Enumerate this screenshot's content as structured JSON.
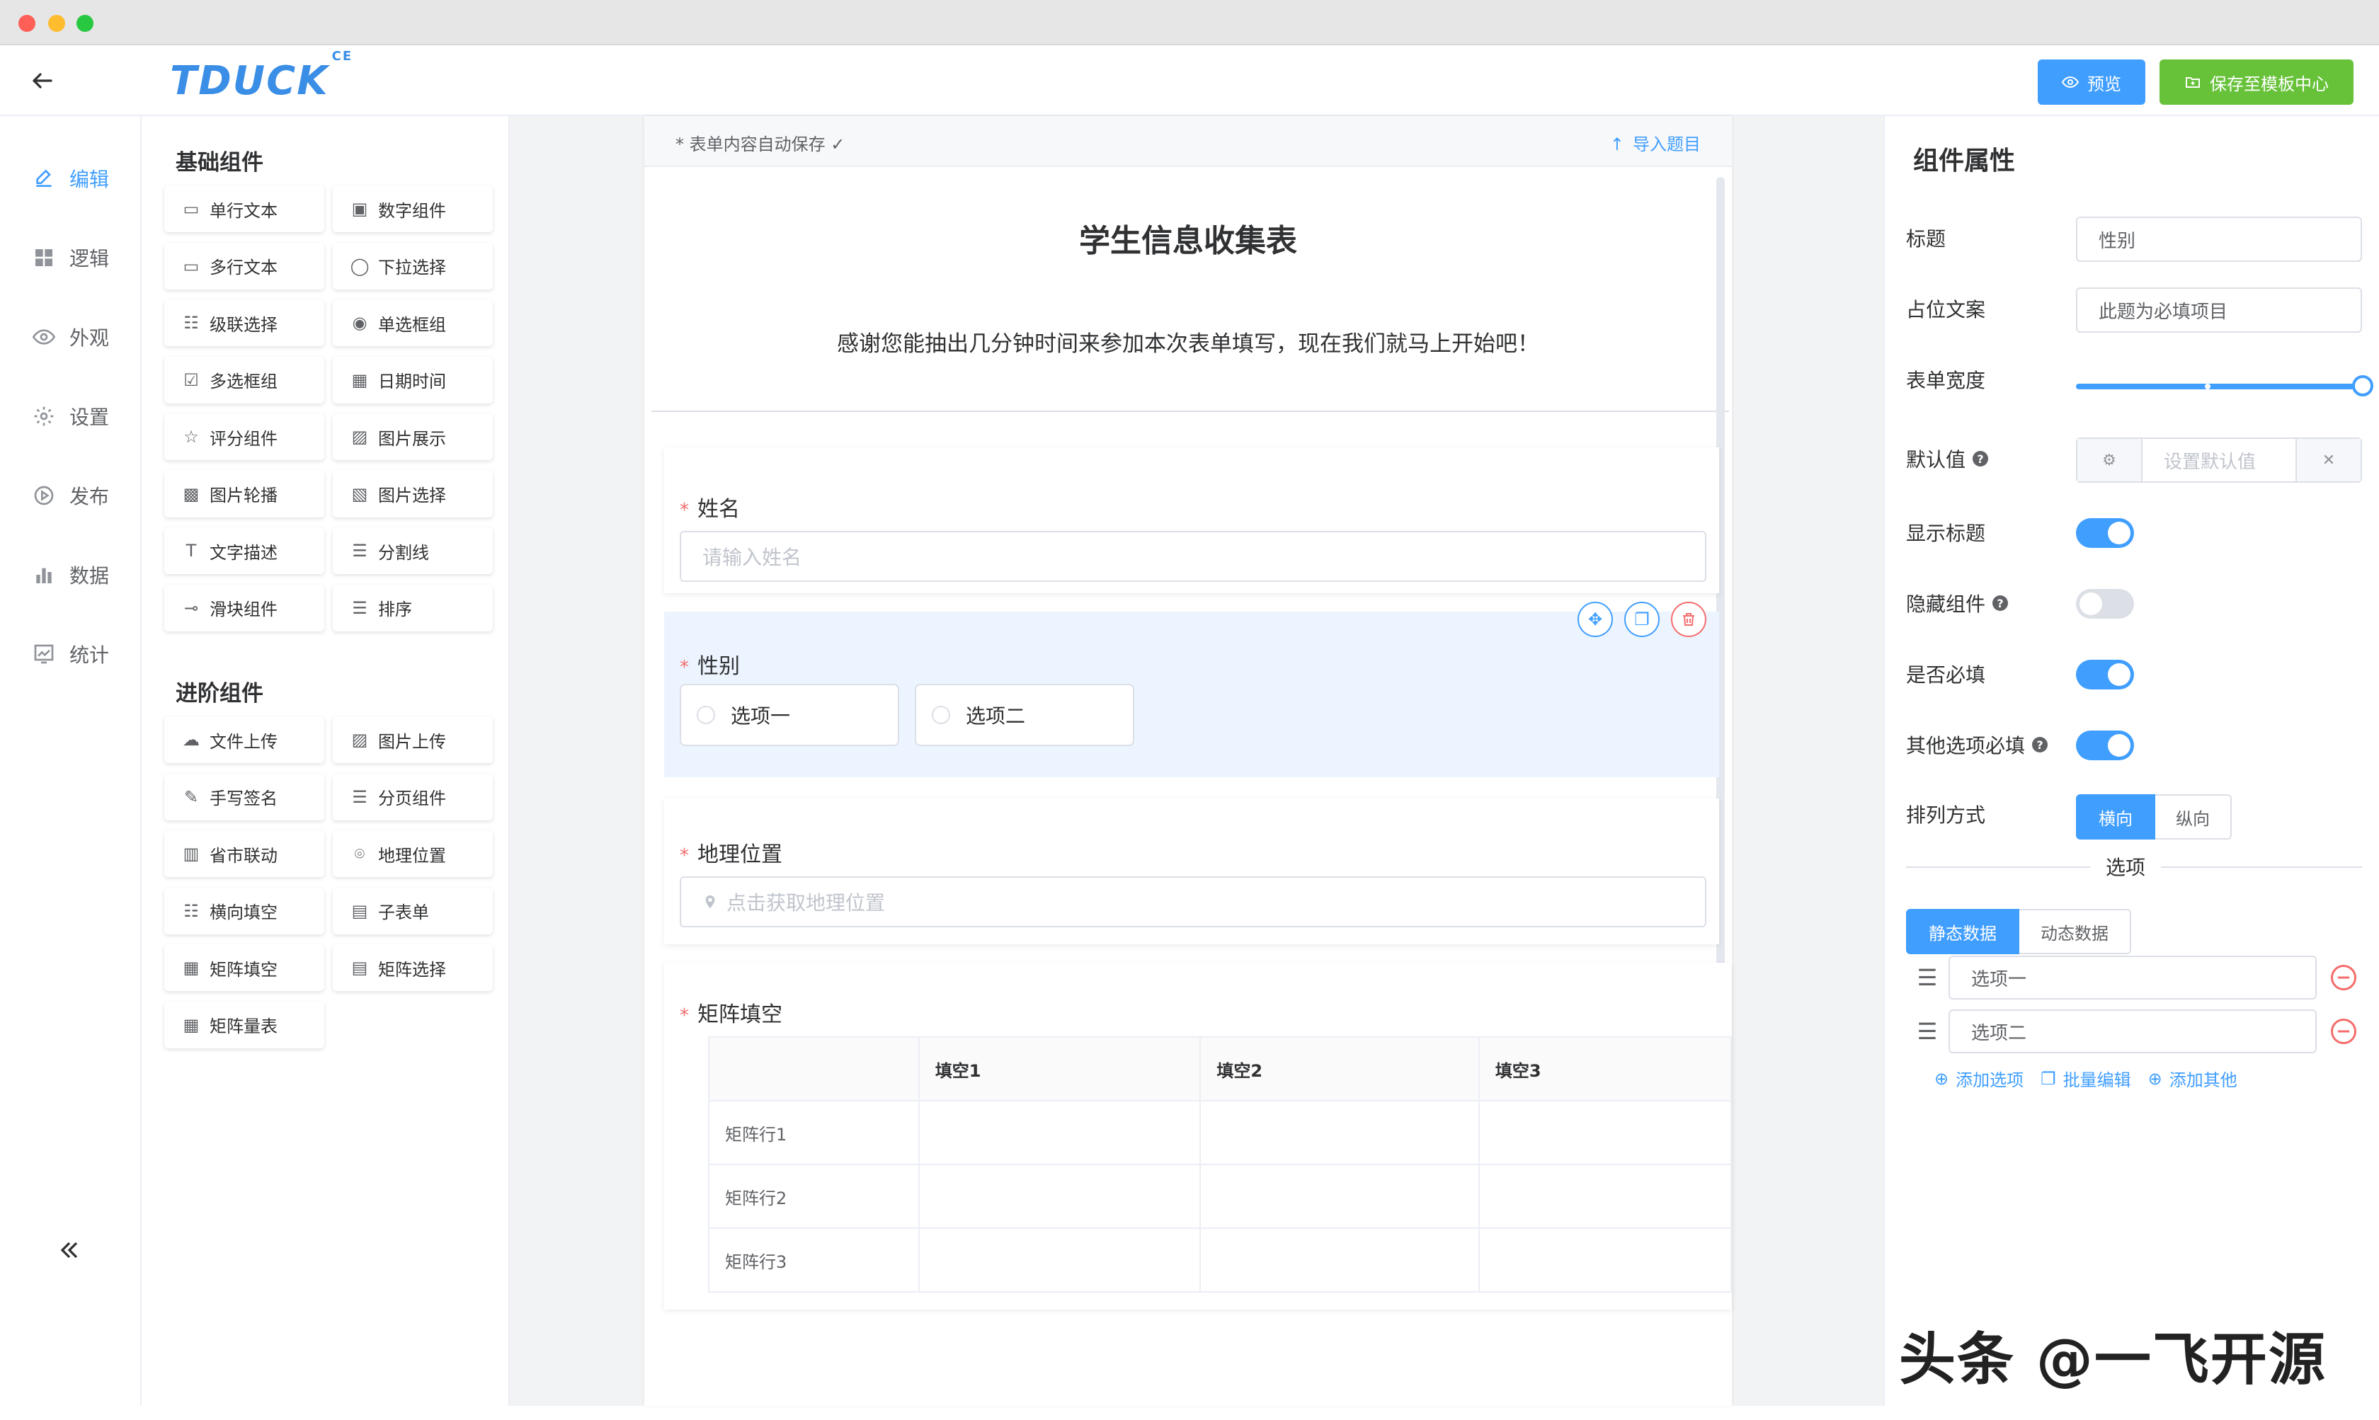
{
  "app": {
    "logo": "TDUCK",
    "logo_sup": "CE"
  },
  "header": {
    "preview_label": "预览",
    "save_label": "保存至模板中心"
  },
  "nav": {
    "items": [
      {
        "label": "编辑",
        "icon": "edit-icon",
        "active": true
      },
      {
        "label": "逻辑",
        "icon": "grid-icon"
      },
      {
        "label": "外观",
        "icon": "eye-icon"
      },
      {
        "label": "设置",
        "icon": "gear-icon"
      },
      {
        "label": "发布",
        "icon": "play-icon"
      },
      {
        "label": "数据",
        "icon": "bar-chart-icon"
      },
      {
        "label": "统计",
        "icon": "trend-icon"
      }
    ]
  },
  "palette": {
    "basic_title": "基础组件",
    "basic": [
      "单行文本",
      "数字组件",
      "多行文本",
      "下拉选择",
      "级联选择",
      "单选框组",
      "多选框组",
      "日期时间",
      "评分组件",
      "图片展示",
      "图片轮播",
      "图片选择",
      "文字描述",
      "分割线",
      "滑块组件",
      "排序"
    ],
    "advanced_title": "进阶组件",
    "advanced": [
      "文件上传",
      "图片上传",
      "手写签名",
      "分页组件",
      "省市联动",
      "地理位置",
      "横向填空",
      "子表单",
      "矩阵填空",
      "矩阵选择",
      "矩阵量表"
    ]
  },
  "form": {
    "autosave": "* 表单内容自动保存 ✓",
    "import": "导入题目",
    "title": "学生信息收集表",
    "description": "感谢您能抽出几分钟时间来参加本次表单填写，现在我们就马上开始吧！",
    "name_label": "姓名",
    "name_placeholder": "请输入姓名",
    "gender_label": "性别",
    "gender_options": [
      "选项一",
      "选项二"
    ],
    "location_label": "地理位置",
    "location_placeholder": "点击获取地理位置",
    "matrix_label": "矩阵填空",
    "matrix_columns": [
      "填空1",
      "填空2",
      "填空3"
    ],
    "matrix_rows": [
      "矩阵行1",
      "矩阵行2",
      "矩阵行3"
    ]
  },
  "props": {
    "title": "组件属性",
    "label_title": "标题",
    "value_title": "性别",
    "label_placeholder": "占位文案",
    "value_placeholder": "此题为必填项目",
    "label_width": "表单宽度",
    "label_default": "默认值",
    "default_placeholder": "设置默认值",
    "label_show_title": "显示标题",
    "show_title": true,
    "label_hide": "隐藏组件",
    "hide": false,
    "label_required": "是否必填",
    "required": true,
    "label_other_required": "其他选项必填",
    "other_required": true,
    "label_arrange": "排列方式",
    "arrange_options": [
      "横向",
      "纵向"
    ],
    "options_title": "选项",
    "data_tabs": [
      "静态数据",
      "动态数据"
    ],
    "options": [
      "选项一",
      "选项二"
    ],
    "actions": [
      "添加选项",
      "批量编辑",
      "添加其他"
    ]
  },
  "watermark": "头条 @一飞开源",
  "colors": {
    "primary": "#409eff",
    "success": "#67c23a",
    "danger": "#f56c6c"
  }
}
